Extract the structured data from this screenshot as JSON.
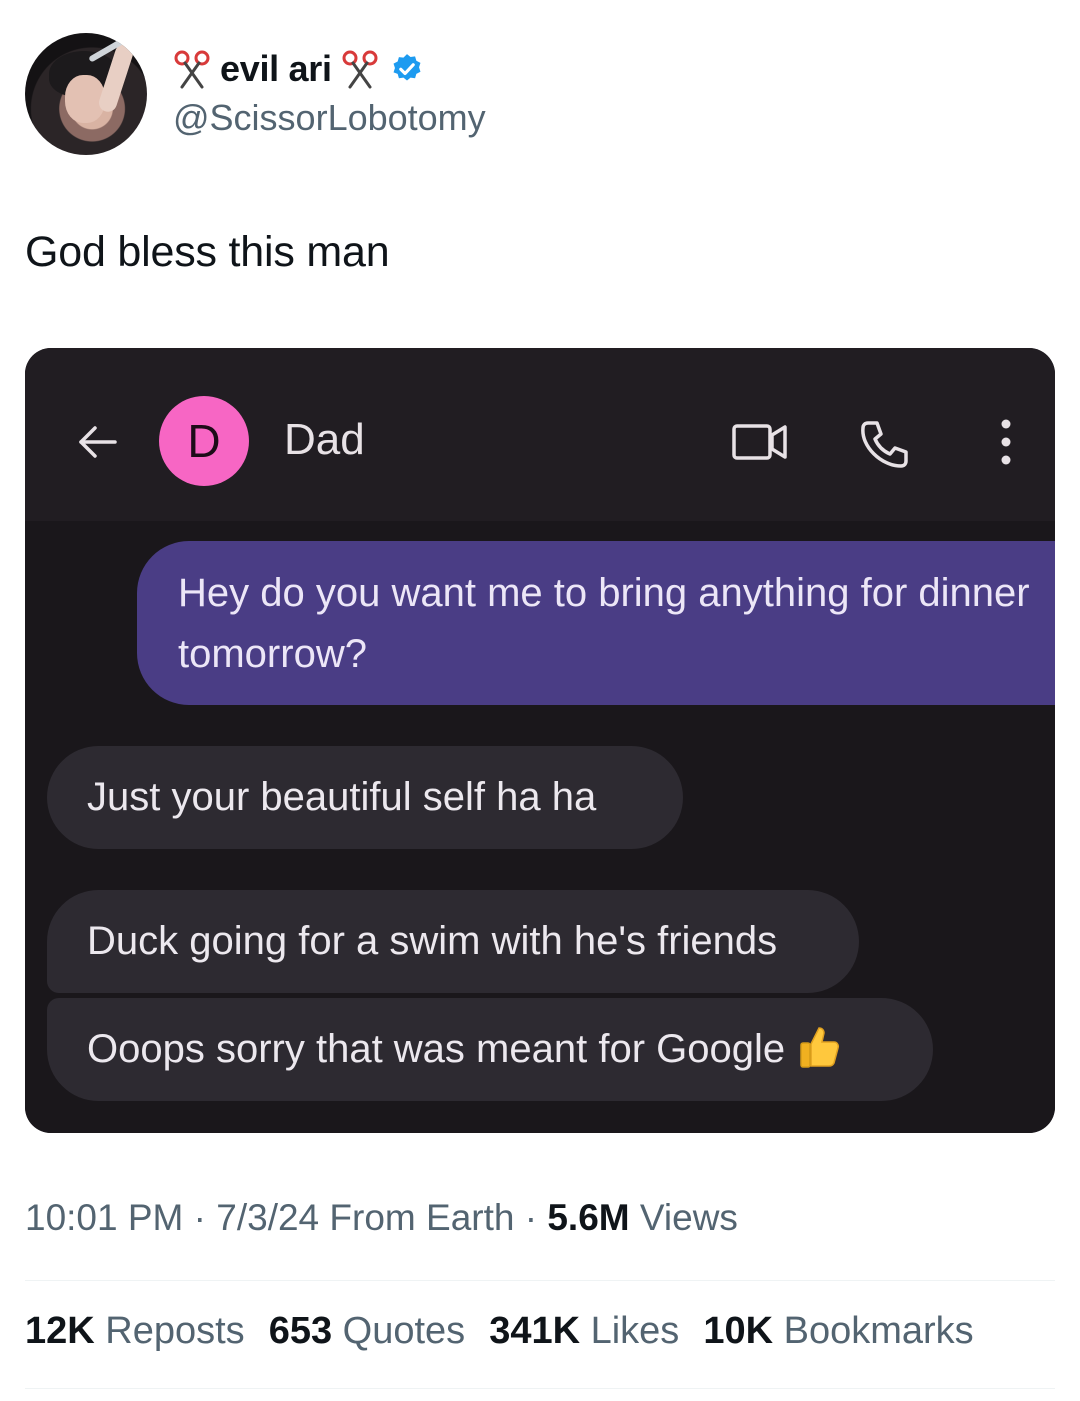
{
  "author": {
    "display_name": "evil ari",
    "handle": "@ScissorLobotomy",
    "name_emoji": "scissors-icon",
    "verified_badge": "verified-icon",
    "verified_color": "#1d9bf0"
  },
  "tweet": {
    "text": "God bless this man"
  },
  "media": {
    "back_icon": "arrow-left-icon",
    "contact": {
      "initial": "D",
      "name": "Dad",
      "avatar_color": "#f766c4"
    },
    "actions": [
      "video-call-icon",
      "phone-icon",
      "more-vertical-icon"
    ],
    "messages": [
      {
        "direction": "outgoing",
        "text": "Hey do you want me to bring anything for dinner tomorrow?"
      },
      {
        "direction": "incoming",
        "text": "Just your beautiful self ha ha"
      },
      {
        "direction": "incoming",
        "text": "Duck going for a swim with he's friends"
      },
      {
        "direction": "incoming",
        "text": "Ooops sorry that was meant for Google",
        "emoji": "thumbs-up-icon"
      }
    ],
    "colors": {
      "background": "#1a171b",
      "outgoing_bubble": "#4a3d85",
      "incoming_bubble": "#2d2a31"
    }
  },
  "meta": {
    "time": "10:01 PM",
    "date": "7/3/24",
    "location": "From Earth",
    "views_count": "5.6M",
    "views_label": "Views"
  },
  "stats": {
    "reposts_count": "12K",
    "reposts_label": "Reposts",
    "quotes_count": "653",
    "quotes_label": "Quotes",
    "likes_count": "341K",
    "likes_label": "Likes",
    "bookmarks_count": "10K",
    "bookmarks_label": "Bookmarks"
  }
}
